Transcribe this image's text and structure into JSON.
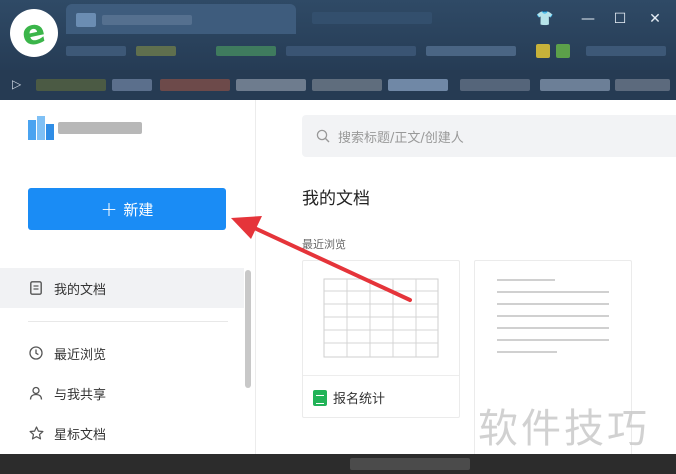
{
  "window": {
    "controls": {
      "skin": "👕",
      "minimize": "—",
      "maximize": "☐",
      "close": "✕"
    },
    "bookmark_arrow": "▷"
  },
  "sidebar": {
    "new_button": {
      "icon": "+",
      "label": "新建"
    },
    "nav": [
      {
        "icon": "document-icon",
        "label": "我的文档",
        "active": true
      },
      {
        "icon": "clock-icon",
        "label": "最近浏览",
        "active": false
      },
      {
        "icon": "person-icon",
        "label": "与我共享",
        "active": false
      },
      {
        "icon": "star-icon",
        "label": "星标文档",
        "active": false
      }
    ]
  },
  "main": {
    "search_placeholder": "搜索标题/正文/创建人",
    "title": "我的文档",
    "section_label": "最近浏览",
    "cards": [
      {
        "name": "报名统计",
        "type": "spreadsheet"
      },
      {
        "name": "",
        "type": "document"
      }
    ]
  },
  "watermark": "软件技巧",
  "colors": {
    "accent": "#1a8cf5",
    "sheet_green": "#22b358",
    "arrow": "#e5343a"
  }
}
